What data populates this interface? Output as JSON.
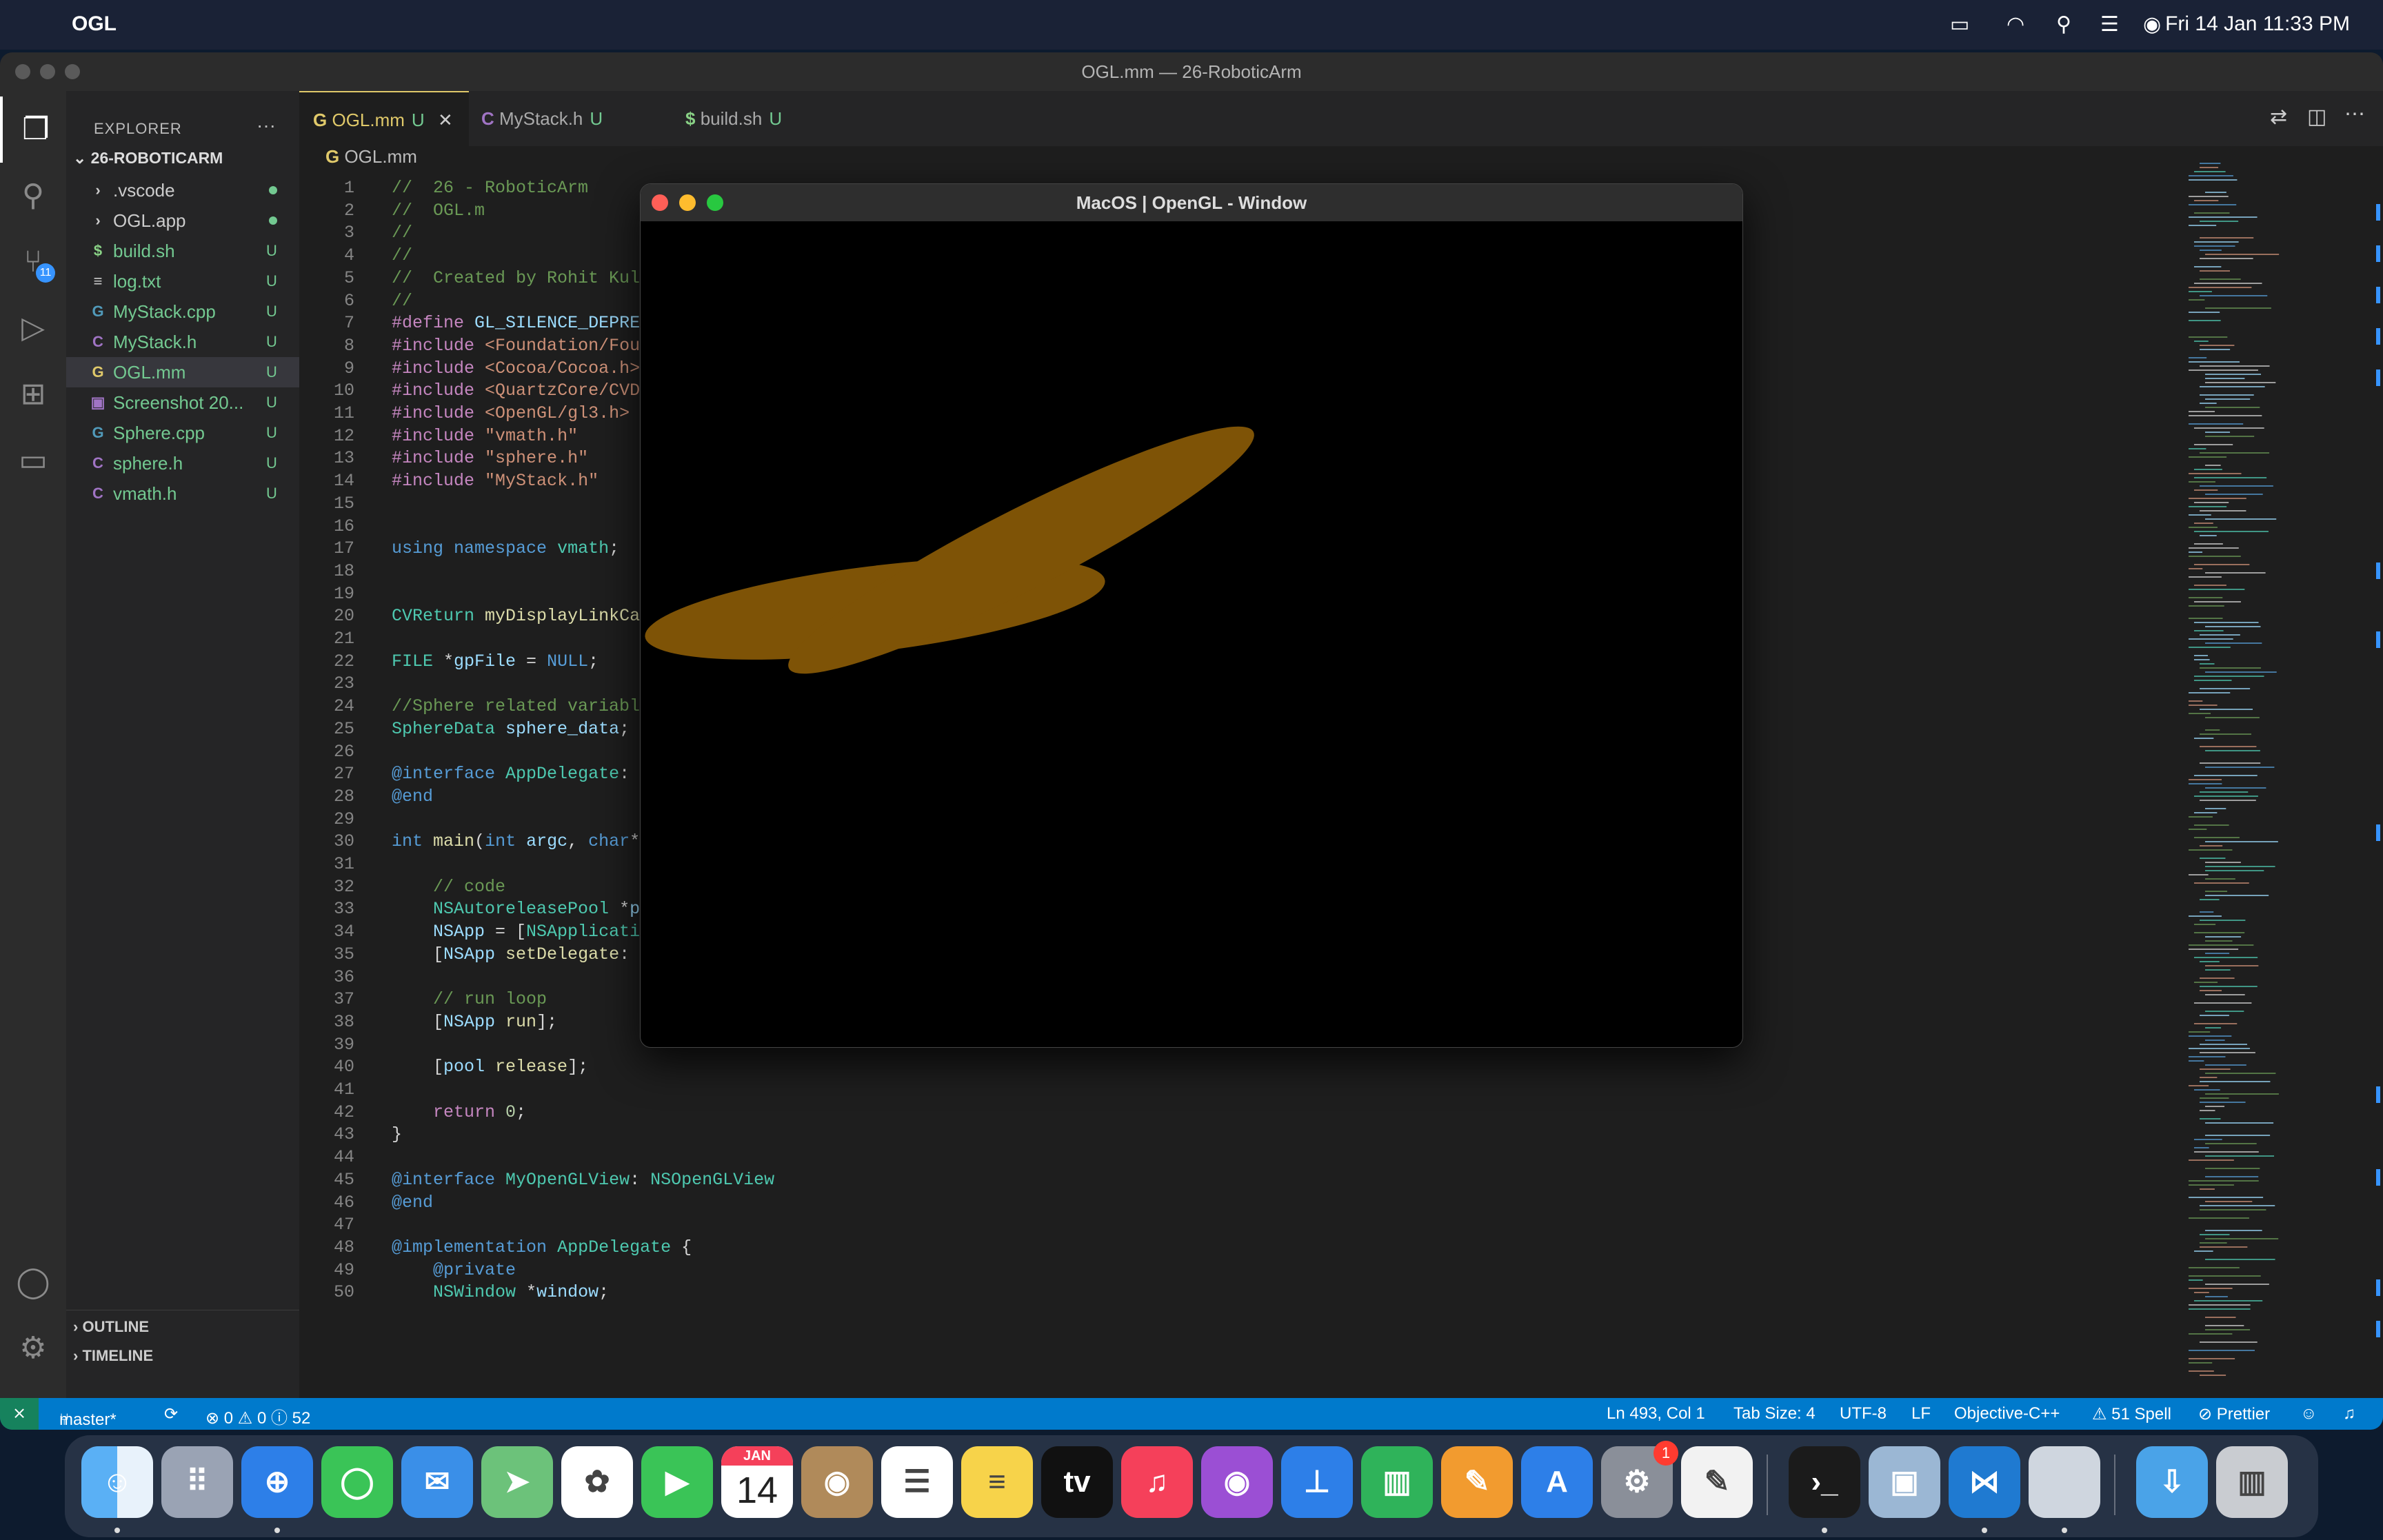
{
  "menubar": {
    "app_name": "OGL",
    "clock": "Fri 14 Jan  11:33 PM"
  },
  "vscode": {
    "title": "OGL.mm — 26-RoboticArm",
    "explorer_label": "EXPLORER",
    "more": "···",
    "folder": "26-ROBOTICARM",
    "source_control_count": "11",
    "files": [
      {
        "icon": "›",
        "icon_color": "#ccc",
        "name": ".vscode",
        "status": "",
        "dot": true
      },
      {
        "icon": "›",
        "icon_color": "#ccc",
        "name": "OGL.app",
        "status": "",
        "dot": true
      },
      {
        "icon": "$",
        "icon_color": "#89d185",
        "name": "build.sh",
        "status": "U",
        "dot": false
      },
      {
        "icon": "≡",
        "icon_color": "#ccc",
        "name": "log.txt",
        "status": "U",
        "dot": false
      },
      {
        "icon": "G",
        "icon_color": "#519aba",
        "name": "MyStack.cpp",
        "status": "U",
        "dot": false
      },
      {
        "icon": "C",
        "icon_color": "#a074c4",
        "name": "MyStack.h",
        "status": "U",
        "dot": false
      },
      {
        "icon": "G",
        "icon_color": "#e0c96a",
        "name": "OGL.mm",
        "status": "U",
        "dot": false,
        "active": true
      },
      {
        "icon": "▣",
        "icon_color": "#a074c4",
        "name": "Screenshot 20...",
        "status": "U",
        "dot": false
      },
      {
        "icon": "G",
        "icon_color": "#519aba",
        "name": "Sphere.cpp",
        "status": "U",
        "dot": false
      },
      {
        "icon": "C",
        "icon_color": "#a074c4",
        "name": "sphere.h",
        "status": "U",
        "dot": false
      },
      {
        "icon": "C",
        "icon_color": "#a074c4",
        "name": "vmath.h",
        "status": "U",
        "dot": false
      }
    ],
    "outline_label": "OUTLINE",
    "timeline_label": "TIMELINE",
    "tabs": [
      {
        "icon": "G",
        "label": "OGL.mm",
        "status": "U",
        "close": "✕"
      },
      {
        "icon": "C",
        "label": "MyStack.h",
        "status": "U"
      },
      {
        "icon": "$",
        "label": "build.sh",
        "status": "U"
      }
    ],
    "breadcrumb": "OGL.mm",
    "code_lines": [
      {
        "n": "1",
        "html": "<span class='cm'>//  26 - RoboticArm</span>"
      },
      {
        "n": "2",
        "html": "<span class='cm'>//  OGL.m</span>"
      },
      {
        "n": "3",
        "html": "<span class='cm'>//</span>"
      },
      {
        "n": "4",
        "html": "<span class='cm'>//</span>"
      },
      {
        "n": "5",
        "html": "<span class='cm'>//  Created by Rohit Kulk</span>"
      },
      {
        "n": "6",
        "html": "<span class='cm'>//</span>"
      },
      {
        "n": "7",
        "html": "<span class='pp'>#define</span> <span class='vr'>GL_SILENCE_DEPREC</span>"
      },
      {
        "n": "8",
        "html": "<span class='pp'>#include</span> <span class='st2'>&lt;Foundation/Foun</span>"
      },
      {
        "n": "9",
        "html": "<span class='pp'>#include</span> <span class='st2'>&lt;Cocoa/Cocoa.h&gt;</span>"
      },
      {
        "n": "10",
        "html": "<span class='pp'>#include</span> <span class='st2'>&lt;QuartzCore/CVDi</span>"
      },
      {
        "n": "11",
        "html": "<span class='pp'>#include</span> <span class='st2'>&lt;OpenGL/gl3.h&gt;</span>"
      },
      {
        "n": "12",
        "html": "<span class='pp'>#include</span> <span class='st2'>\"vmath.h\"</span>"
      },
      {
        "n": "13",
        "html": "<span class='pp'>#include</span> <span class='st2'>\"sphere.h\"</span>      <span class='cm'>/</span>"
      },
      {
        "n": "14",
        "html": "<span class='pp'>#include</span> <span class='st2'>\"MyStack.h\"</span>    <span class='cm'>/</span>"
      },
      {
        "n": "15",
        "html": ""
      },
      {
        "n": "16",
        "html": ""
      },
      {
        "n": "17",
        "html": "<span class='kw'>using</span> <span class='kw'>namespace</span> <span class='ty'>vmath</span>;"
      },
      {
        "n": "18",
        "html": ""
      },
      {
        "n": "19",
        "html": ""
      },
      {
        "n": "20",
        "html": "<span class='ty'>CVReturn</span> <span class='fn'>myDisplayLinkCal</span>"
      },
      {
        "n": "21",
        "html": ""
      },
      {
        "n": "22",
        "html": "<span class='ty'>FILE</span> *<span class='vr'>gpFile</span> = <span class='kw'>NULL</span>;"
      },
      {
        "n": "23",
        "html": ""
      },
      {
        "n": "24",
        "html": "<span class='cm'>//Sphere related variable</span>"
      },
      {
        "n": "25",
        "html": "<span class='ty'>SphereData</span> <span class='vr'>sphere_data</span>;"
      },
      {
        "n": "26",
        "html": ""
      },
      {
        "n": "27",
        "html": "<span class='kw'>@interface</span> <span class='ty'>AppDelegate</span>: <span class='ty'>N</span>"
      },
      {
        "n": "28",
        "html": "<span class='kw'>@end</span>"
      },
      {
        "n": "29",
        "html": ""
      },
      {
        "n": "30",
        "html": "<span class='kw'>int</span> <span class='fn'>main</span>(<span class='kw'>int</span> <span class='vr'>argc</span>, <span class='kw'>char</span>*"
      },
      {
        "n": "31",
        "html": ""
      },
      {
        "n": "32",
        "html": "    <span class='cm'>// code</span>"
      },
      {
        "n": "33",
        "html": "    <span class='ty'>NSAutoreleasePool</span> *<span class='vr'>po</span>"
      },
      {
        "n": "34",
        "html": "    <span class='vr'>NSApp</span> = [<span class='ty'>NSApplicatio</span>"
      },
      {
        "n": "35",
        "html": "    [<span class='vr'>NSApp</span> <span class='fn'>setDelegate</span>: ["
      },
      {
        "n": "36",
        "html": ""
      },
      {
        "n": "37",
        "html": "    <span class='cm'>// run loop</span>"
      },
      {
        "n": "38",
        "html": "    [<span class='vr'>NSApp</span> <span class='fn'>run</span>];"
      },
      {
        "n": "39",
        "html": ""
      },
      {
        "n": "40",
        "html": "    [<span class='vr'>pool</span> <span class='fn'>release</span>];"
      },
      {
        "n": "41",
        "html": ""
      },
      {
        "n": "42",
        "html": "    <span class='pp'>return</span> <span class='nm2'>0</span>;"
      },
      {
        "n": "43",
        "html": "}"
      },
      {
        "n": "44",
        "html": ""
      },
      {
        "n": "45",
        "html": "<span class='kw'>@interface</span> <span class='ty'>MyOpenGLView</span>: <span class='ty'>NSOpenGLView</span>"
      },
      {
        "n": "46",
        "html": "<span class='kw'>@end</span>"
      },
      {
        "n": "47",
        "html": ""
      },
      {
        "n": "48",
        "html": "<span class='kw'>@implementation</span> <span class='ty'>AppDelegate</span> {"
      },
      {
        "n": "49",
        "html": "    <span class='kw'>@private</span>"
      },
      {
        "n": "50",
        "html": "    <span class='ty'>NSWindow</span> *<span class='vr'>window</span>;"
      }
    ],
    "status": {
      "branch": "master*",
      "problems": "⊗ 0 ⚠ 0 ⓘ 52",
      "position": "Ln 493, Col 1",
      "tab_size": "Tab Size: 4",
      "encoding": "UTF-8",
      "eol": "LF",
      "language": "Objective-C++",
      "spell": "⚠ 51 Spell",
      "prettier": "⊘ Prettier"
    }
  },
  "glwindow": {
    "title": "MacOS | OpenGL - Window",
    "shape_color": "#7e5306"
  },
  "dock": {
    "calendar_month": "JAN",
    "calendar_day": "14",
    "settings_badge": "1",
    "apps": [
      "finder-icon",
      "launchpad-icon",
      "safari-icon",
      "messages-icon",
      "mail-icon",
      "maps-icon",
      "photos-icon",
      "facetime-icon",
      "calendar-icon",
      "contacts-icon",
      "reminders-icon",
      "notes-icon",
      "tv-icon",
      "music-icon",
      "podcasts-icon",
      "keynote-icon",
      "numbers-icon",
      "pages-icon",
      "app-store-icon",
      "system-preferences-icon",
      "textedit-icon",
      "terminal-icon",
      "preview-icon",
      "vscode-icon",
      "blank-app-icon",
      "downloads-icon",
      "trash-icon"
    ]
  }
}
